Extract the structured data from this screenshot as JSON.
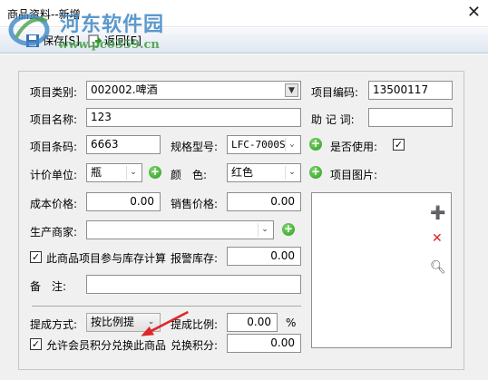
{
  "window": {
    "title": "商品资料--新增",
    "close_label": "✕"
  },
  "watermark": {
    "line1": "河东软件园",
    "line2": "www.pc0359.cn"
  },
  "toolbar": {
    "save_label": "保存[S]",
    "back_label": "返回[E]"
  },
  "form": {
    "category_label": "项目类别:",
    "category_value": "002002.啤酒",
    "code_label": "项目编码:",
    "code_value": "13500117",
    "name_label": "项目名称:",
    "name_value": "123",
    "mnemonic_label": "助 记 词:",
    "mnemonic_value": "",
    "barcode_label": "项目条码:",
    "barcode_value": "6663",
    "spec_label": "规格型号:",
    "spec_value": "LFC-7000S",
    "enabled_label": "是否使用:",
    "enabled_checked": "✓",
    "unit_label": "计价单位:",
    "unit_value": "瓶",
    "color_label": "颜　色:",
    "color_value": "红色",
    "image_label": "项目图片:",
    "cost_label": "成本价格:",
    "cost_value": "0.00",
    "sale_label": "销售价格:",
    "sale_value": "0.00",
    "maker_label": "生产商家:",
    "maker_value": "",
    "stock_calc_label": "此商品项目参与库存计算",
    "stock_calc_checked": "✓",
    "alarm_label": "报警库存:",
    "alarm_value": "0.00",
    "remark_label": "备　注:",
    "remark_value": "",
    "commission_mode_label": "提成方式:",
    "commission_mode_value": "按比例提",
    "commission_ratio_label": "提成比例:",
    "commission_ratio_value": "0.00",
    "commission_ratio_unit": "%",
    "points_allow_label": "允许会员积分兑换此商品",
    "points_allow_checked": "✓",
    "points_label": "兑换积分:",
    "points_value": "0.00"
  },
  "image_tools": {
    "add": "add-image",
    "delete": "delete-image",
    "view": "view-image"
  },
  "colors": {
    "toolbar": "#dfe7f1",
    "panel": "#f0f0f0",
    "plus": "#2c9a1f",
    "delete": "#e02020",
    "arrow": "#e0262b"
  }
}
